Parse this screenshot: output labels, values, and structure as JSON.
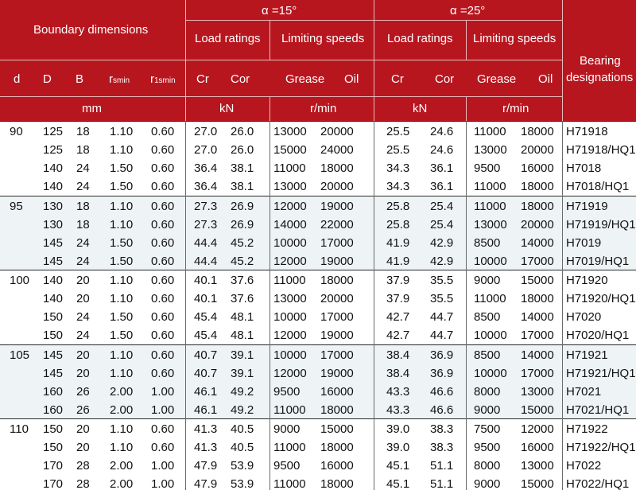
{
  "header": {
    "boundary_dimensions": "Boundary dimensions",
    "alpha15": "α =15°",
    "alpha25": "α =25°",
    "load_ratings": "Load ratings",
    "limiting_speeds": "Limiting speeds",
    "bearing_designations_1": "Bearing",
    "bearing_designations_2": "designations",
    "col_d": "d",
    "col_D": "D",
    "col_B": "B",
    "col_rsmin_r": "r",
    "col_rsmin_sub": "smin",
    "col_r1smin_r": "r",
    "col_r1smin_sub": "1smin",
    "col_cr": "Cr",
    "col_cor": "Cor",
    "col_grease": "Grease",
    "col_oil": "Oil",
    "unit_mm": "mm",
    "unit_kn": "kN",
    "unit_rmin": "r/min"
  },
  "groups": [
    {
      "d": "90",
      "rows": [
        [
          "125",
          "18",
          "1.10",
          "0.60",
          "27.0",
          "26.0",
          "13000",
          "20000",
          "25.5",
          "24.6",
          "11000",
          "18000",
          "H71918"
        ],
        [
          "125",
          "18",
          "1.10",
          "0.60",
          "27.0",
          "26.0",
          "15000",
          "24000",
          "25.5",
          "24.6",
          "13000",
          "20000",
          "H71918/HQ1"
        ],
        [
          "140",
          "24",
          "1.50",
          "0.60",
          "36.4",
          "38.1",
          "11000",
          "18000",
          "34.3",
          "36.1",
          "9500",
          "16000",
          "H7018"
        ],
        [
          "140",
          "24",
          "1.50",
          "0.60",
          "36.4",
          "38.1",
          "13000",
          "20000",
          "34.3",
          "36.1",
          "11000",
          "18000",
          "H7018/HQ1"
        ]
      ]
    },
    {
      "d": "95",
      "rows": [
        [
          "130",
          "18",
          "1.10",
          "0.60",
          "27.3",
          "26.9",
          "12000",
          "19000",
          "25.8",
          "25.4",
          "11000",
          "18000",
          "H71919"
        ],
        [
          "130",
          "18",
          "1.10",
          "0.60",
          "27.3",
          "26.9",
          "14000",
          "22000",
          "25.8",
          "25.4",
          "13000",
          "20000",
          "H71919/HQ1"
        ],
        [
          "145",
          "24",
          "1.50",
          "0.60",
          "44.4",
          "45.2",
          "10000",
          "17000",
          "41.9",
          "42.9",
          "8500",
          "14000",
          "H7019"
        ],
        [
          "145",
          "24",
          "1.50",
          "0.60",
          "44.4",
          "45.2",
          "12000",
          "19000",
          "41.9",
          "42.9",
          "10000",
          "17000",
          "H7019/HQ1"
        ]
      ]
    },
    {
      "d": "100",
      "rows": [
        [
          "140",
          "20",
          "1.10",
          "0.60",
          "40.1",
          "37.6",
          "11000",
          "18000",
          "37.9",
          "35.5",
          "9000",
          "15000",
          "H71920"
        ],
        [
          "140",
          "20",
          "1.10",
          "0.60",
          "40.1",
          "37.6",
          "13000",
          "20000",
          "37.9",
          "35.5",
          "11000",
          "18000",
          "H71920/HQ1"
        ],
        [
          "150",
          "24",
          "1.50",
          "0.60",
          "45.4",
          "48.1",
          "10000",
          "17000",
          "42.7",
          "44.7",
          "8500",
          "14000",
          "H7020"
        ],
        [
          "150",
          "24",
          "1.50",
          "0.60",
          "45.4",
          "48.1",
          "12000",
          "19000",
          "42.7",
          "44.7",
          "10000",
          "17000",
          "H7020/HQ1"
        ]
      ]
    },
    {
      "d": "105",
      "rows": [
        [
          "145",
          "20",
          "1.10",
          "0.60",
          "40.7",
          "39.1",
          "10000",
          "17000",
          "38.4",
          "36.9",
          "8500",
          "14000",
          "H71921"
        ],
        [
          "145",
          "20",
          "1.10",
          "0.60",
          "40.7",
          "39.1",
          "12000",
          "19000",
          "38.4",
          "36.9",
          "10000",
          "17000",
          "H71921/HQ1"
        ],
        [
          "160",
          "26",
          "2.00",
          "1.00",
          "46.1",
          "49.2",
          "9500",
          "16000",
          "43.3",
          "46.6",
          "8000",
          "13000",
          "H7021"
        ],
        [
          "160",
          "26",
          "2.00",
          "1.00",
          "46.1",
          "49.2",
          "11000",
          "18000",
          "43.3",
          "46.6",
          "9000",
          "15000",
          "H7021/HQ1"
        ]
      ]
    },
    {
      "d": "110",
      "rows": [
        [
          "150",
          "20",
          "1.10",
          "0.60",
          "41.3",
          "40.5",
          "9000",
          "15000",
          "39.0",
          "38.3",
          "7500",
          "12000",
          "H71922"
        ],
        [
          "150",
          "20",
          "1.10",
          "0.60",
          "41.3",
          "40.5",
          "11000",
          "18000",
          "39.0",
          "38.3",
          "9500",
          "16000",
          "H71922/HQ1"
        ],
        [
          "170",
          "28",
          "2.00",
          "1.00",
          "47.9",
          "53.9",
          "9500",
          "16000",
          "45.1",
          "51.1",
          "8000",
          "13000",
          "H7022"
        ],
        [
          "170",
          "28",
          "2.00",
          "1.00",
          "47.9",
          "53.9",
          "11000",
          "18000",
          "45.1",
          "51.1",
          "9000",
          "15000",
          "H7022/HQ1"
        ]
      ]
    }
  ]
}
